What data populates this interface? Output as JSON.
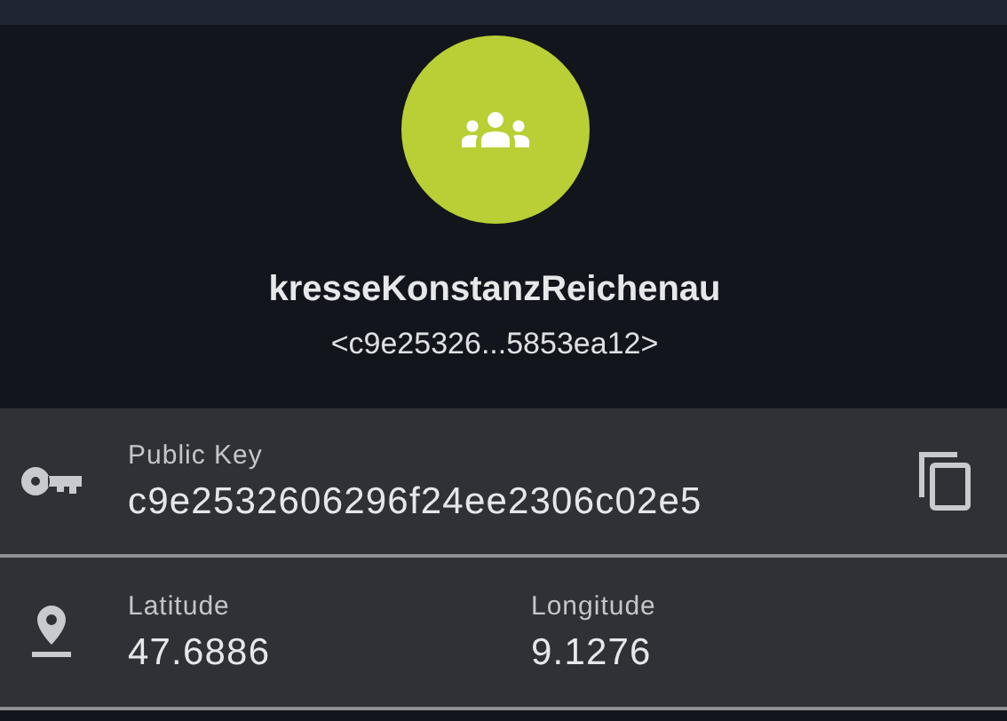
{
  "contact": {
    "name": "kresseKonstanzReichenau",
    "short_id": "<c9e25326...5853ea12>"
  },
  "public_key": {
    "label": "Public Key",
    "value": "c9e2532606296f24ee2306c02e5"
  },
  "location": [
    {
      "label": "Latitude",
      "value": "47.6886"
    },
    {
      "label": "Longitude",
      "value": "9.1276"
    }
  ]
}
